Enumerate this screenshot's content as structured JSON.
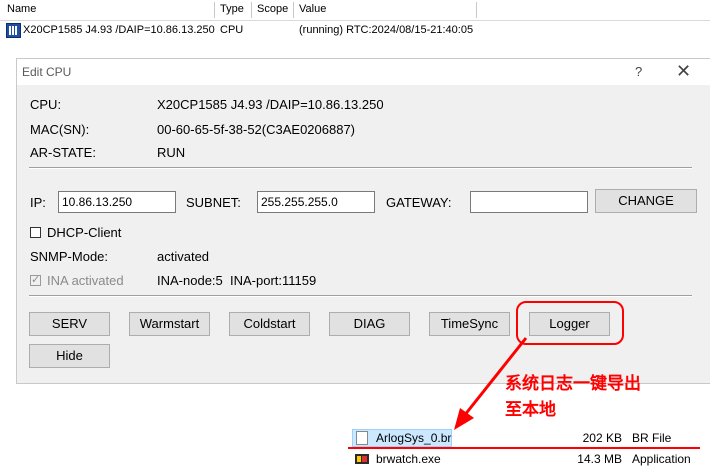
{
  "list": {
    "columns": [
      "Name",
      "Type",
      "Scope",
      "Value"
    ],
    "row": {
      "name": "X20CP1585 J4.93 /DAIP=10.86.13.250",
      "type": "CPU",
      "scope": "",
      "value": "(running) RTC:2024/08/15-21:40:05",
      "icon": "cpu-module-icon"
    }
  },
  "dialog": {
    "title": "Edit CPU",
    "help": "?",
    "close": "✕",
    "cpu_label": "CPU:",
    "cpu_value": "X20CP1585 J4.93 /DAIP=10.86.13.250",
    "mac_label": "MAC(SN):",
    "mac_value": "00-60-65-5f-38-52(C3AE0206887)",
    "ar_label": "AR-STATE:",
    "ar_value": "RUN",
    "ip_label": "IP:",
    "ip_value": "10.86.13.250",
    "subnet_label": "SUBNET:",
    "subnet_value": "255.255.255.0",
    "gateway_label": "GATEWAY:",
    "gateway_value": "",
    "change_button": "CHANGE",
    "dhcp_label": "DHCP-Client",
    "dhcp_checked": false,
    "snmp_label": "SNMP-Mode:",
    "snmp_value": "activated",
    "ina_label": "INA activated",
    "ina_checked": true,
    "ina_node": "INA-node:5",
    "ina_port": "INA-port:11159",
    "buttons": {
      "serv": "SERV",
      "warmstart": "Warmstart",
      "coldstart": "Coldstart",
      "diag": "DIAG",
      "timesync": "TimeSync",
      "logger": "Logger",
      "hide": "Hide"
    }
  },
  "annotation": {
    "line1": "系统日志一键导出",
    "line2": "至本地",
    "color": "#ff0000"
  },
  "files": [
    {
      "name": "ArlogSys_0.br",
      "size": "202 KB",
      "type": "BR File",
      "icon": "br-file-icon"
    },
    {
      "name": "brwatch.exe",
      "size": "14.3 MB",
      "type": "Application",
      "icon": "brwatch-app-icon"
    }
  ]
}
